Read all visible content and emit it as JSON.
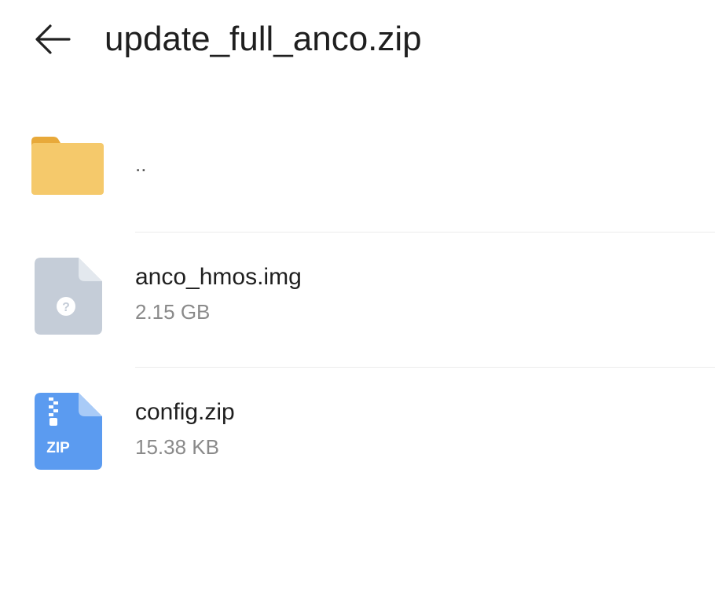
{
  "header": {
    "title": "update_full_anco.zip",
    "back_icon": "arrow-left-icon"
  },
  "files": [
    {
      "name": "..",
      "size": "",
      "icon": "folder-icon",
      "color": "#F5C96B"
    },
    {
      "name": "anco_hmos.img",
      "size": "2.15 GB",
      "icon": "unknown-file-icon",
      "color": "#C5CDD8"
    },
    {
      "name": "config.zip",
      "size": "15.38 KB",
      "icon": "zip-file-icon",
      "color": "#5B9BF0",
      "badge": "ZIP"
    }
  ],
  "unknown_glyph": "?"
}
